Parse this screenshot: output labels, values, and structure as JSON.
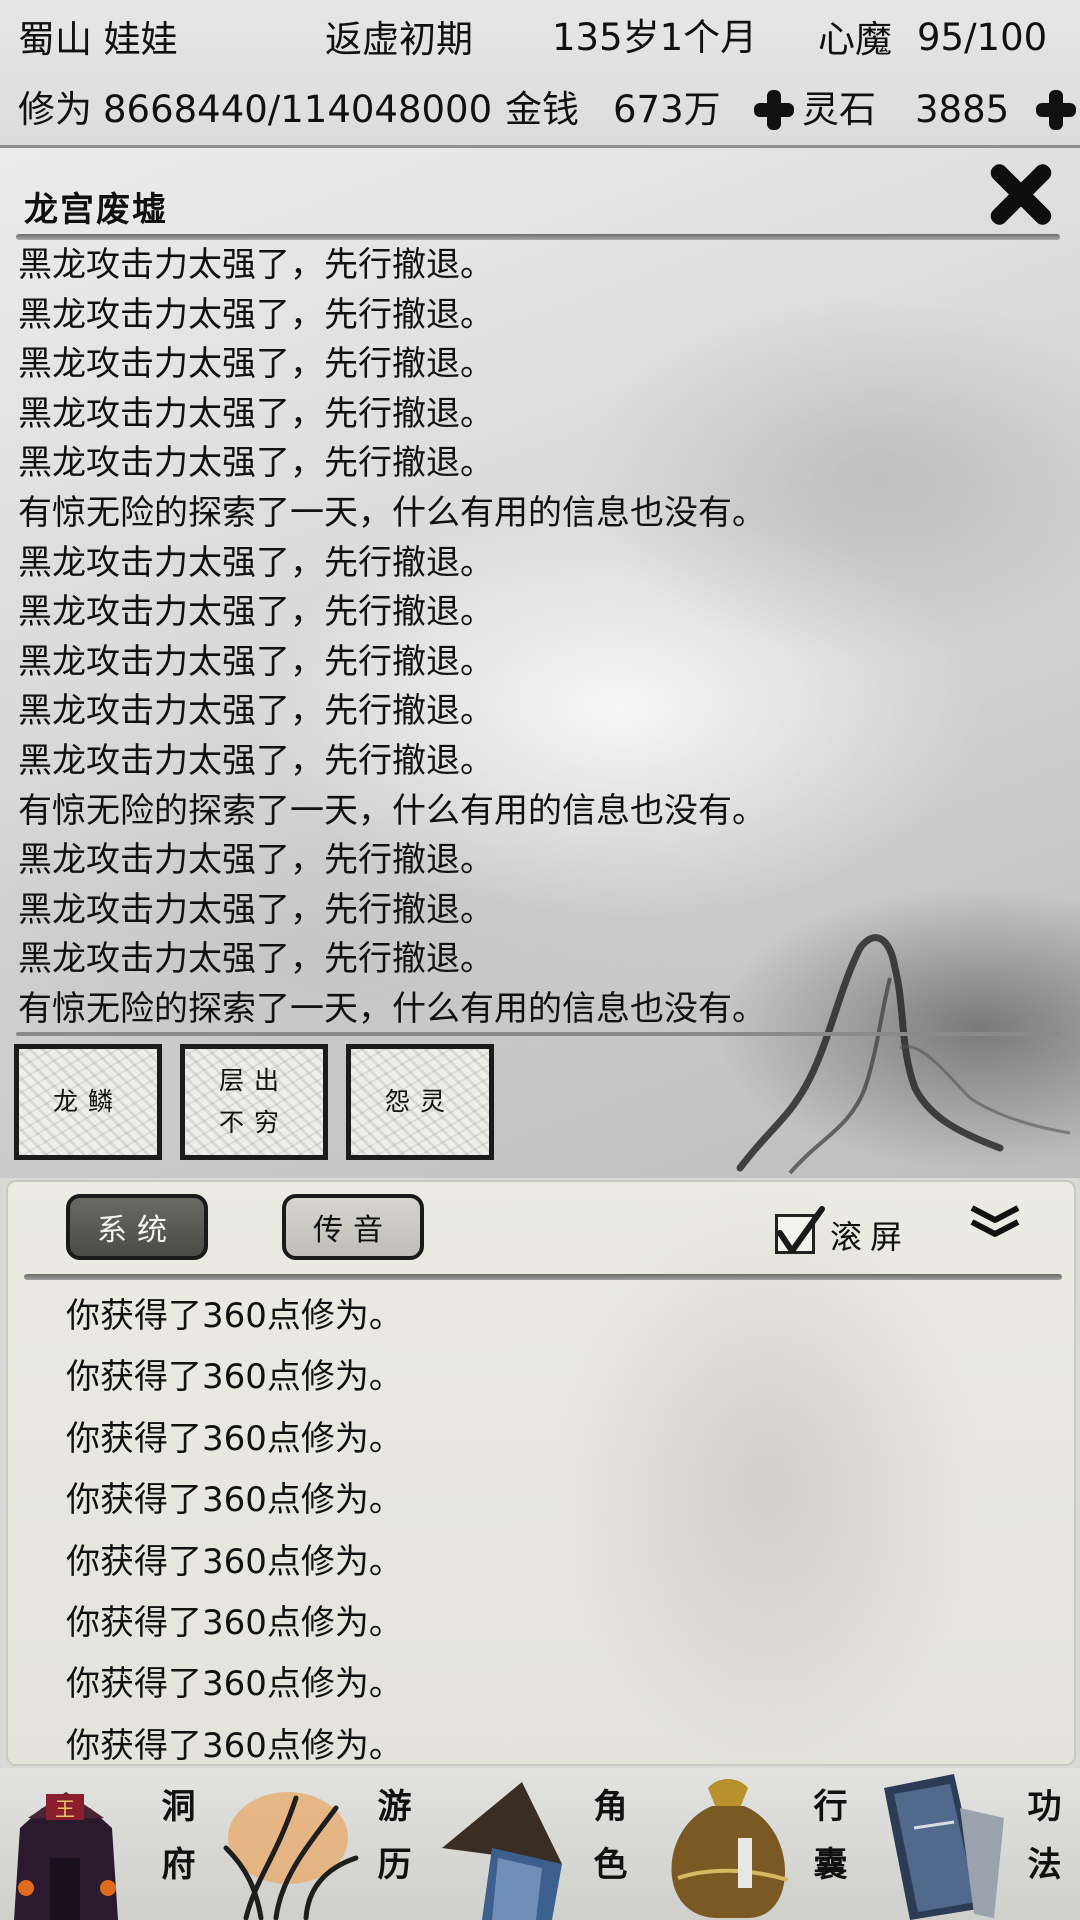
{
  "status": {
    "sect_and_name": "蜀山 娃娃",
    "realm": "返虚初期",
    "age": "135岁1个月",
    "heart_demon_label": "心魔",
    "heart_demon_value": "95/100",
    "cultivation_label": "修为",
    "cultivation_value": "8668440/114048000",
    "money_label": "金钱",
    "money_value": "673万",
    "spirit_stone_label": "灵石",
    "spirit_stone_value": "3885"
  },
  "location": {
    "title": "龙宫废墟",
    "log": [
      "黑龙攻击力太强了，先行撤退。",
      "黑龙攻击力太强了，先行撤退。",
      "黑龙攻击力太强了，先行撤退。",
      "黑龙攻击力太强了，先行撤退。",
      "黑龙攻击力太强了，先行撤退。",
      "有惊无险的探索了一天，什么有用的信息也没有。",
      "黑龙攻击力太强了，先行撤退。",
      "黑龙攻击力太强了，先行撤退。",
      "黑龙攻击力太强了，先行撤退。",
      "黑龙攻击力太强了，先行撤退。",
      "黑龙攻击力太强了，先行撤退。",
      "有惊无险的探索了一天，什么有用的信息也没有。",
      "黑龙攻击力太强了，先行撤退。",
      "黑龙攻击力太强了，先行撤退。",
      "黑龙攻击力太强了，先行撤退。",
      "有惊无险的探索了一天，什么有用的信息也没有。"
    ],
    "actions": [
      "龙鳞",
      "层出不穷",
      "怨灵"
    ]
  },
  "chat": {
    "tabs": [
      "系统",
      "传音"
    ],
    "active_tab": "系统",
    "scroll_label": "滚屏",
    "scroll_checked": true,
    "messages": [
      "你获得了360点修为。",
      "你获得了360点修为。",
      "你获得了360点修为。",
      "你获得了360点修为。",
      "你获得了360点修为。",
      "你获得了360点修为。",
      "你获得了360点修为。",
      "你获得了360点修为。"
    ]
  },
  "nav": {
    "items": [
      {
        "label": "洞府",
        "icon": "cave-dwelling-icon"
      },
      {
        "label": "游历",
        "icon": "travel-grass-icon"
      },
      {
        "label": "角色",
        "icon": "character-hat-icon"
      },
      {
        "label": "行囊",
        "icon": "bag-icon"
      },
      {
        "label": "功法",
        "icon": "book-icon"
      }
    ]
  }
}
